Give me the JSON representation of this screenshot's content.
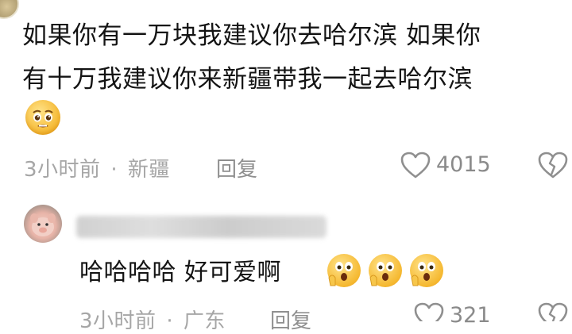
{
  "comment": {
    "text_line1": "如果你有一万块我建议你去哈尔滨 如果你",
    "text_line2": "有十万我建议你来新疆带我一起去哈尔滨",
    "emoji": "pleading-face-emoji",
    "time": "3小时前",
    "separator": "·",
    "location": "新疆",
    "reply_label": "回复",
    "like_count": "4015"
  },
  "reply": {
    "text": "哈哈哈哈  好可爱啊",
    "emojis": [
      "shocked-face-emoji",
      "shocked-face-emoji",
      "shocked-face-emoji"
    ],
    "time": "3小时前",
    "separator": "·",
    "location": "广东",
    "reply_label": "回复",
    "like_count": "321"
  },
  "icons": {
    "like": "heart-outline-icon",
    "dislike": "broken-heart-icon"
  },
  "colors": {
    "text": "#141414",
    "meta": "#a6a6a6",
    "emoji_yellow": "#f5b830"
  }
}
